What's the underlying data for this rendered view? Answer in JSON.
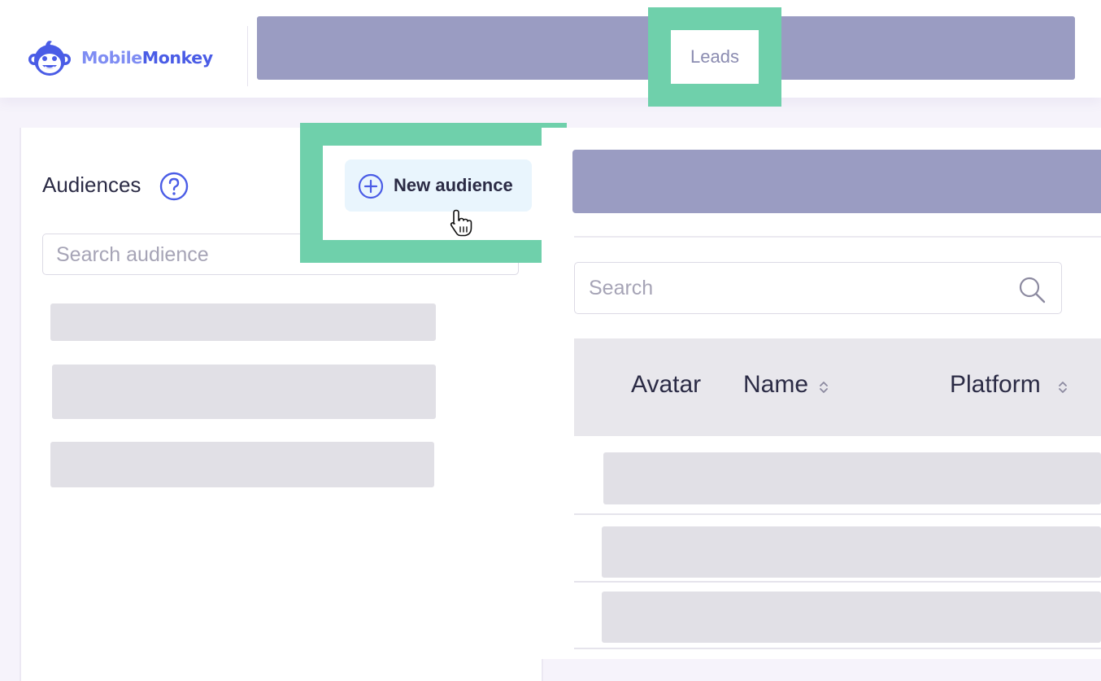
{
  "header": {
    "logo": {
      "text_light": "Mobile",
      "text_bold": "Monkey"
    },
    "nav": {
      "leads_tab": "Leads"
    }
  },
  "audiences": {
    "title": "Audiences",
    "new_button": "New audience",
    "search_placeholder": "Search audience"
  },
  "leads_table": {
    "search_placeholder": "Search",
    "columns": [
      "Avatar",
      "Name",
      "Platform"
    ]
  },
  "colors": {
    "highlight": "#6fd0ab",
    "brand_blue": "#4a5ce6",
    "brand_light": "#7f8df3",
    "placeholder_bar": "#9a9cc2",
    "skeleton": "#e1e0e6"
  },
  "icons": [
    "monkey-logo-icon",
    "help-circle-icon",
    "plus-circle-icon",
    "hand-pointer-cursor-icon",
    "search-icon",
    "sort-icon"
  ]
}
